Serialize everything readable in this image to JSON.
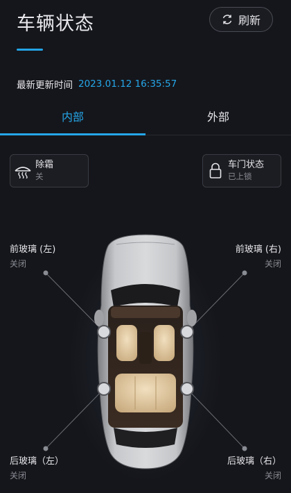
{
  "header": {
    "title": "车辆状态",
    "refresh_label": "刷新"
  },
  "update": {
    "label": "最新更新时间",
    "time": "2023.01.12 16:35:57"
  },
  "tabs": [
    {
      "label": "内部",
      "active": true
    },
    {
      "label": "外部",
      "active": false
    }
  ],
  "cards": {
    "defrost": {
      "title": "除霜",
      "status": "关",
      "icon": "defrost-icon"
    },
    "door": {
      "title": "车门状态",
      "status": "已上锁",
      "icon": "lock-icon"
    }
  },
  "windows": {
    "front_left": {
      "label": "前玻璃 (左)",
      "state": "关闭"
    },
    "front_right": {
      "label": "前玻璃 (右)",
      "state": "关闭"
    },
    "rear_left": {
      "label": "后玻璃（左）",
      "state": "关闭"
    },
    "rear_right": {
      "label": "后玻璃（右）",
      "state": "关闭"
    }
  },
  "colors": {
    "accent": "#25a7ea",
    "background": "#15161b",
    "car_body": "#b9bbbe",
    "seat": "#e0c7a0"
  }
}
